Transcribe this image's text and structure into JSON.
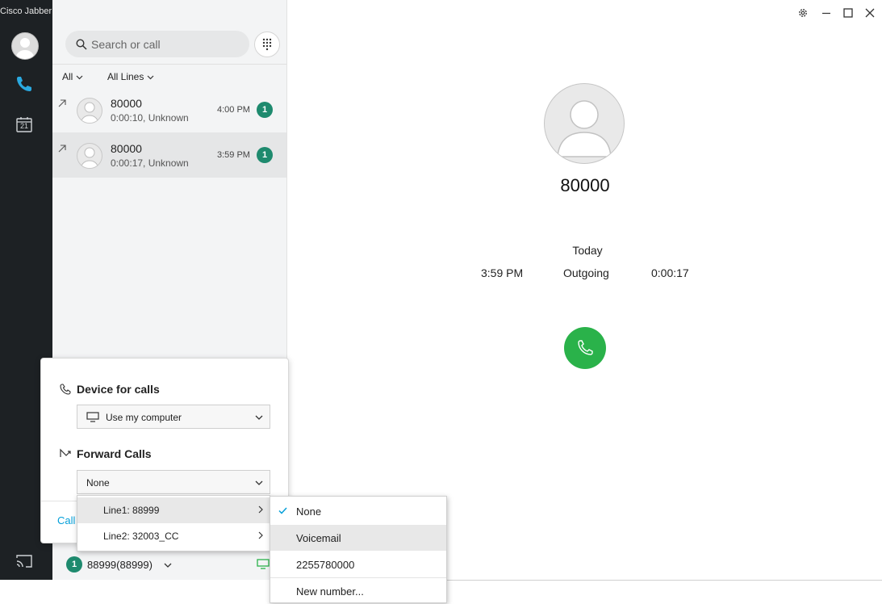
{
  "app": {
    "title": "Cisco Jabber"
  },
  "rail": {
    "calendar_day": "21"
  },
  "search": {
    "placeholder": "Search or call"
  },
  "filters": {
    "type": "All",
    "lines": "All Lines"
  },
  "calls": [
    {
      "number": "80000",
      "detail": "0:00:10, Unknown",
      "time": "4:00 PM",
      "count": "1",
      "selected": false
    },
    {
      "number": "80000",
      "detail": "0:00:17, Unknown",
      "time": "3:59 PM",
      "count": "1",
      "selected": true
    }
  ],
  "detail": {
    "name": "80000",
    "day": "Today",
    "time": "3:59 PM",
    "direction": "Outgoing",
    "duration": "0:00:17"
  },
  "popup": {
    "device_heading": "Device for calls",
    "device_value": "Use my computer",
    "forward_heading": "Forward Calls",
    "forward_value": "None",
    "call_link": "Call"
  },
  "lines_menu": [
    {
      "label": "Line1: 88999",
      "highlight": true
    },
    {
      "label": "Line2: 32003_CC",
      "highlight": false
    }
  ],
  "forward_menu": [
    {
      "label": "None",
      "checked": true
    },
    {
      "label": "Voicemail",
      "highlight": true
    },
    {
      "label": "2255780000"
    },
    {
      "label": "New number..."
    }
  ],
  "status": {
    "badge": "1",
    "line": "88999(88999)"
  },
  "colors": {
    "accent": "#1e8a6e",
    "call_green": "#2ab24a",
    "rail": "#1d2124",
    "link": "#049fd9"
  }
}
